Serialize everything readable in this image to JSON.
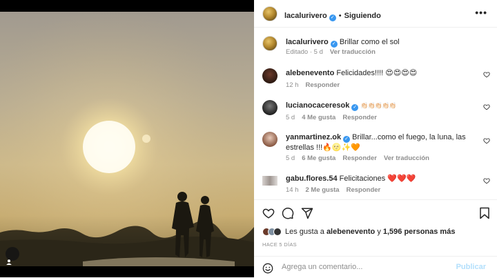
{
  "post": {
    "author": "lacalurivero",
    "follow_label": "Siguiendo",
    "more_label": "•••",
    "caption": "Brillar como el sol",
    "caption_meta_edited": "Editado · 5 d",
    "caption_meta_translate": "Ver traducción"
  },
  "comments": [
    {
      "user": "alebenevento",
      "text": "Felicidades!!!! 😍😍😍😍",
      "time": "12 h",
      "likes": "",
      "reply": "Responder",
      "translate": ""
    },
    {
      "user": "lucianocaceresok",
      "verified": true,
      "text": "👏🏻👏🏻👏🏻👏🏻👏🏻",
      "time": "5 d",
      "likes": "4 Me gusta",
      "reply": "Responder",
      "translate": ""
    },
    {
      "user": "yanmartinez.ok",
      "verified": true,
      "text": "Brillar...como el fuego, la luna, las estrellas !!!🔥🌝✨🧡",
      "time": "5 d",
      "likes": "6 Me gusta",
      "reply": "Responder",
      "translate": "Ver traducción"
    },
    {
      "user": "gabu.flores.54",
      "text": "Felicitaciones ❤️❤️❤️",
      "time": "14 h",
      "likes": "2 Me gusta",
      "reply": "Responder",
      "translate": ""
    }
  ],
  "footer": {
    "liked_prefix": "Les gusta a",
    "liked_user": "alebenevento",
    "liked_mid": "y",
    "liked_count": "1,596 personas más",
    "time_ago": "HACE 5 DÍAS",
    "comment_placeholder": "Agrega un comentario...",
    "publish_label": "Publicar"
  },
  "icons": {
    "like": "heart-icon",
    "comment": "comment-icon",
    "share": "share-icon",
    "save": "bookmark-icon",
    "emoji": "smile-icon",
    "tag": "user-tag-icon"
  },
  "colors": {
    "verified": "#3897f0",
    "publish_disabled": "#b2dffc",
    "meta_gray": "#8e8e8e"
  }
}
